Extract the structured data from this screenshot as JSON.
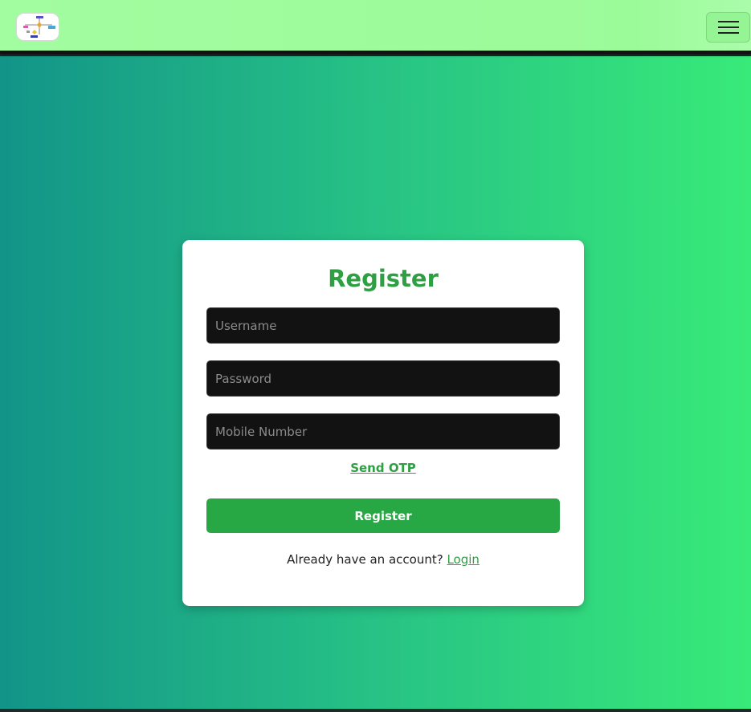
{
  "navbar": {
    "logo_icon": "flowchart-logo-icon",
    "toggler_icon": "hamburger-menu-icon",
    "background": "#9cfb99"
  },
  "page": {
    "gradient_start": "#129488",
    "gradient_end": "#38ea79"
  },
  "register_form": {
    "title": "Register",
    "username_placeholder": "Username",
    "password_placeholder": "Password",
    "mobile_placeholder": "Mobile Number",
    "send_otp_label": "Send OTP",
    "register_button_label": "Register",
    "login_prompt": "Already have an account?",
    "login_link_label": "Login",
    "accent_color": "#28a745"
  }
}
